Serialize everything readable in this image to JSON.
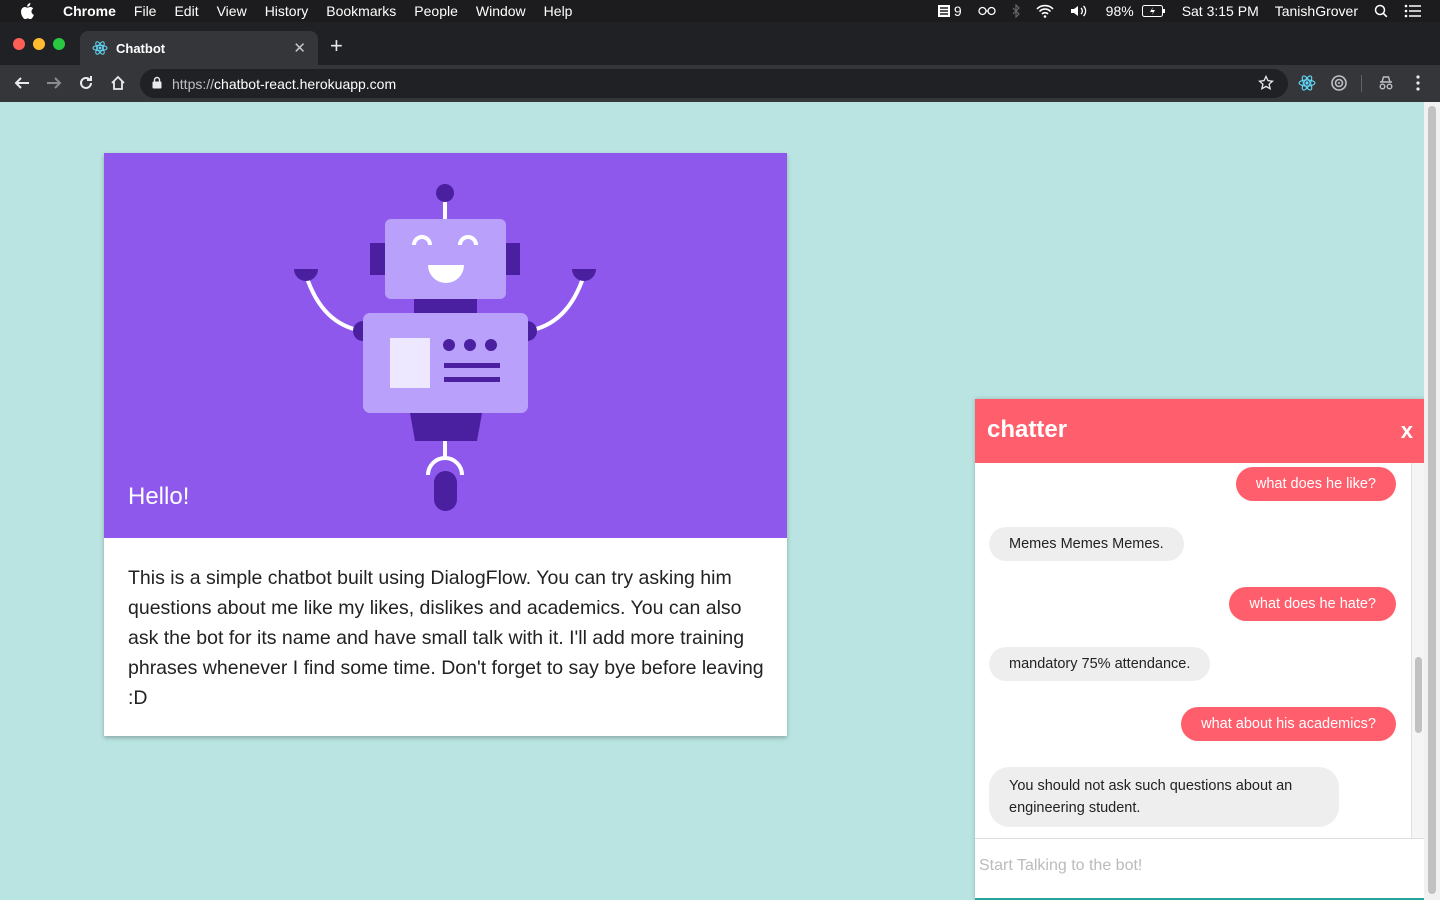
{
  "menubar": {
    "app_name": "Chrome",
    "items": [
      "File",
      "Edit",
      "View",
      "History",
      "Bookmarks",
      "People",
      "Window",
      "Help"
    ],
    "status_count": "9",
    "battery": "98%",
    "clock": "Sat 3:15 PM",
    "user": "TanishGrover"
  },
  "browser": {
    "tab_title": "Chatbot",
    "url_scheme": "https://",
    "url_host": "chatbot-react.herokuapp.com"
  },
  "card": {
    "hero_title": "Hello!",
    "body": "This is a simple chatbot built using DialogFlow. You can try asking him questions about me like my likes, dislikes and academics. You can also ask the bot for its name and have small talk with it. I'll add more training phrases whenever I find some time. Don't forget to say bye before leaving :D"
  },
  "chat": {
    "title": "chatter",
    "close_label": "x",
    "input_placeholder": "Start Talking to the bot!",
    "messages": [
      {
        "from": "user",
        "text": "what does he like?"
      },
      {
        "from": "bot",
        "text": "Memes Memes Memes."
      },
      {
        "from": "user",
        "text": "what does he hate?"
      },
      {
        "from": "bot",
        "text": "mandatory 75% attendance."
      },
      {
        "from": "user",
        "text": "what about his academics?"
      },
      {
        "from": "bot",
        "text": "You should not ask such questions about an engineering student."
      }
    ]
  },
  "colors": {
    "page_bg": "#b9e4e1",
    "hero_bg": "#8f58ec",
    "chat_accent": "#ff5f6d"
  }
}
